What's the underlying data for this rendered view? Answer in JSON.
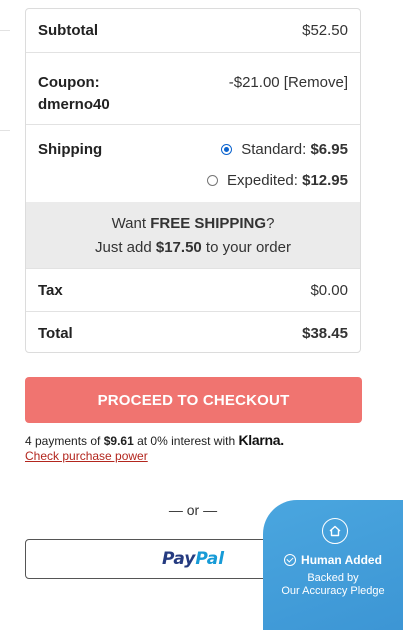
{
  "summary": {
    "subtotal": {
      "label": "Subtotal",
      "value": "$52.50"
    },
    "coupon": {
      "label": "Coupon:",
      "code": "dmerno40",
      "amount": "-$21.00",
      "remove_label": "[Remove]"
    },
    "shipping": {
      "label": "Shipping",
      "options": [
        {
          "name": "Standard:",
          "price": "$6.95",
          "selected": true
        },
        {
          "name": "Expedited:",
          "price": "$12.95",
          "selected": false
        }
      ]
    },
    "free_shipping": {
      "prefix": "Want ",
      "highlight": "FREE SHIPPING",
      "suffix": "?",
      "add_prefix": "Just add ",
      "add_amount": "$17.50",
      "add_suffix": " to your order"
    },
    "tax": {
      "label": "Tax",
      "value": "$0.00"
    },
    "total": {
      "label": "Total",
      "value": "$38.45"
    }
  },
  "checkout_button": {
    "label": "PROCEED TO CHECKOUT",
    "color": "#f07470"
  },
  "klarna": {
    "text_prefix": "4 payments of ",
    "amount": "$9.61",
    "text_middle": " at 0% interest with ",
    "brand": "Klarna.",
    "link": "Check purchase power"
  },
  "or_separator": "— or —",
  "paypal": {
    "part1": "Pay",
    "part2": "Pal",
    "color1": "#253b80",
    "color2": "#179bd7"
  },
  "badge": {
    "title": "Human Added",
    "line1": "Backed by",
    "line2": "Our Accuracy Pledge",
    "icon": "home-shield-icon",
    "color": "#3c95d4"
  }
}
